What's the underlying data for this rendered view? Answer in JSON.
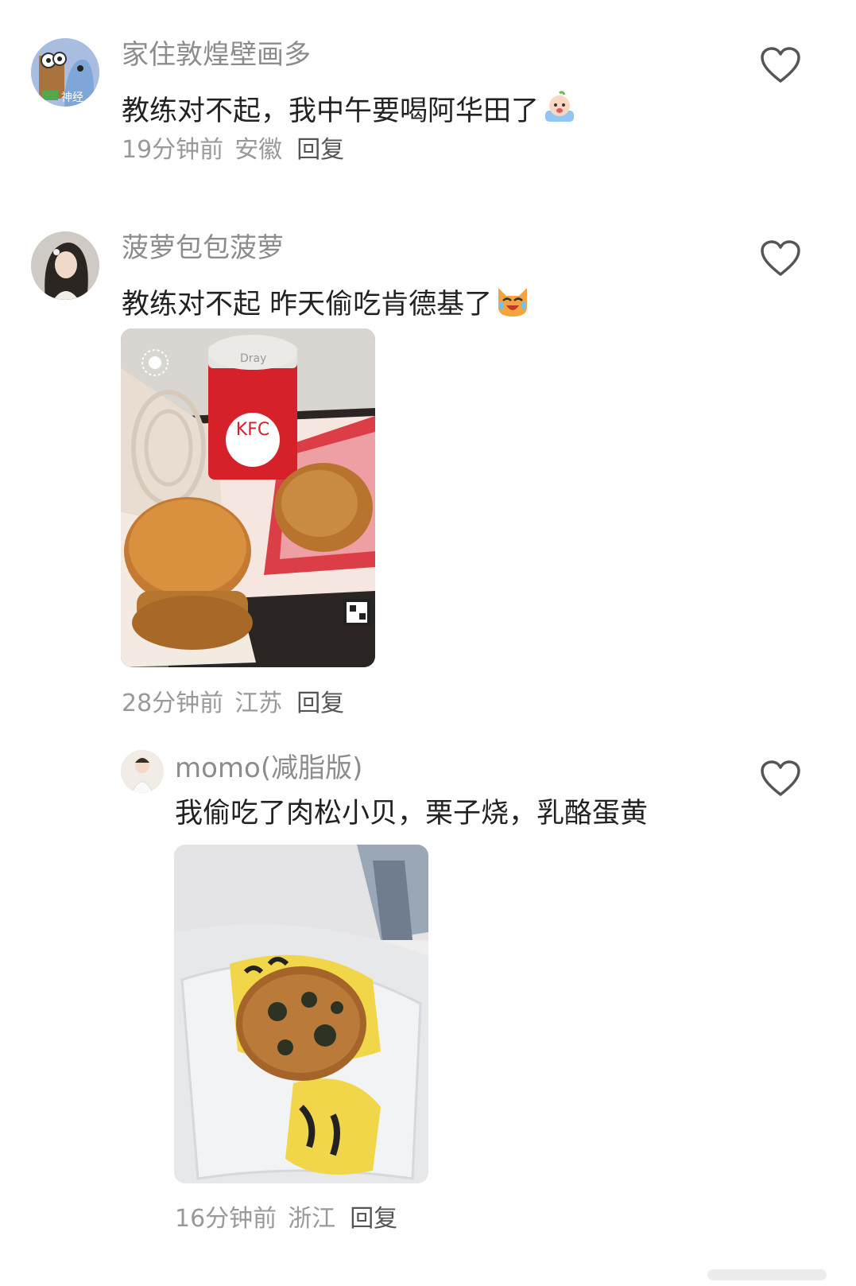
{
  "comments": [
    {
      "username": "家住敦煌壁画多",
      "text": "教练对不起，我中午要喝阿华田了",
      "time": "19分钟前",
      "location": "安徽",
      "reply": "回复",
      "avatar_badge": "神经",
      "emoji": "crying-baby-emoji"
    },
    {
      "username": "菠萝包包菠萝",
      "text": "教练对不起 昨天偷吃肯德基了",
      "time": "28分钟前",
      "location": "江苏",
      "reply": "回复",
      "emoji": "laughing-cat-emoji",
      "photo": {
        "cup_label": "KFC",
        "cup_lid_text": "Dray"
      }
    },
    {
      "username": "momo(减脂版)",
      "text": "我偷吃了肉松小贝，栗子烧，乳酪蛋黄",
      "time": "16分钟前",
      "location": "浙江",
      "reply": "回复"
    }
  ],
  "icons": {
    "like": "heart-outline-icon"
  },
  "colors": {
    "username": "#8c8c8c",
    "text": "#222222",
    "meta": "#999999",
    "kfc_red": "#d6202a"
  }
}
